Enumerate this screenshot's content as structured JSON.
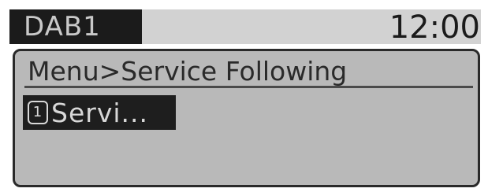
{
  "status_bar": {
    "source": "DAB1",
    "clock": "12:00"
  },
  "menu": {
    "breadcrumb": "Menu>Service Following",
    "items": [
      {
        "preset": "1",
        "label": "Servi..."
      }
    ]
  },
  "colors": {
    "panel_background": "#b9b9b9",
    "highlight_background": "#1e1e1e",
    "highlight_text": "#d8d8d8",
    "text": "#2a2a2a"
  }
}
